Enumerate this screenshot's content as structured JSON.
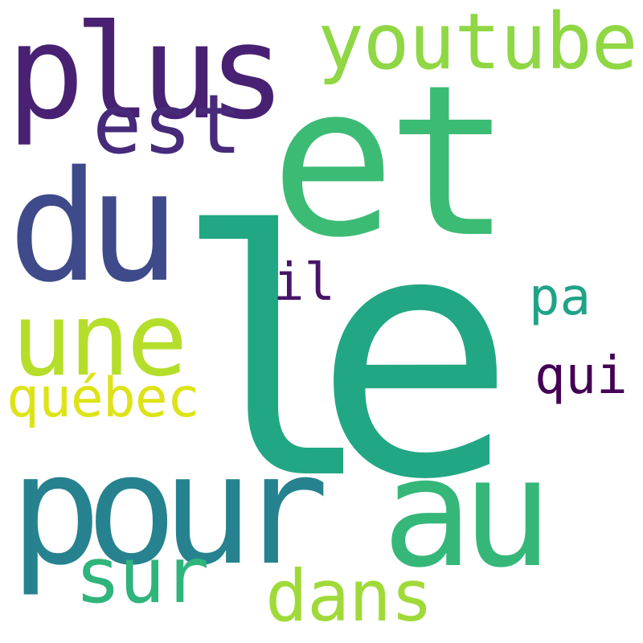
{
  "words": [
    {
      "text": "le",
      "color": "#22a784"
    },
    {
      "text": "et",
      "color": "#3cbb75"
    },
    {
      "text": "plus",
      "color": "#482173"
    },
    {
      "text": "du",
      "color": "#3e4a89"
    },
    {
      "text": "pour",
      "color": "#26828e"
    },
    {
      "text": "au",
      "color": "#35b779"
    },
    {
      "text": "une",
      "color": "#b5de2b"
    },
    {
      "text": "est",
      "color": "#472a7a"
    },
    {
      "text": "youtube",
      "color": "#8fd744"
    },
    {
      "text": "sur",
      "color": "#2fb47c"
    },
    {
      "text": "dans",
      "color": "#a0da39"
    },
    {
      "text": "québec",
      "color": "#dde318"
    },
    {
      "text": "pa",
      "color": "#20a386"
    },
    {
      "text": "qui",
      "color": "#440154"
    },
    {
      "text": "il",
      "color": "#481467"
    }
  ]
}
